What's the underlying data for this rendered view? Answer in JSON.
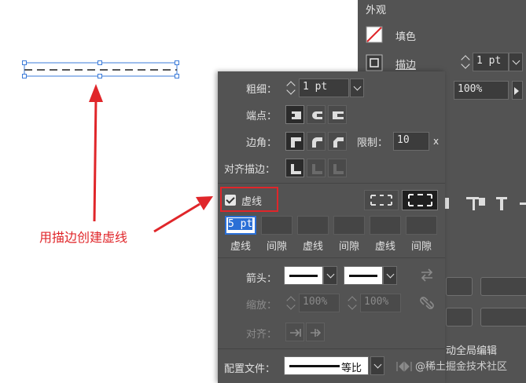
{
  "annotation": {
    "text": "用描边创建虚线"
  },
  "appearance_panel": {
    "title": "外观",
    "fill_label": "填色",
    "stroke_label": "描边",
    "stroke_weight": "1 pt",
    "opacity": "100%",
    "global_edit_label": "动全局编辑"
  },
  "stroke_panel": {
    "weight_label": "粗细：",
    "weight_value": "1 pt",
    "cap_label": "端点：",
    "corner_label": "边角：",
    "limit_label": "限制：",
    "limit_value": "10",
    "limit_unit": "x",
    "align_label": "对齐描边：",
    "dashed_label": "虚线",
    "dash_values": [
      "5 pt",
      "",
      "",
      "",
      "",
      ""
    ],
    "dash_labels": [
      "虚线",
      "间隙",
      "虚线",
      "间隙",
      "虚线",
      "间隙"
    ],
    "arrowhead_label": "箭头：",
    "scale_label": "缩放：",
    "scale_start": "100%",
    "scale_end": "100%",
    "arrow_align_label": "对齐：",
    "profile_label": "配置文件：",
    "profile_value": "等比"
  },
  "watermark": "@稀土掘金技术社区",
  "colors": {
    "panel_bg": "#535353",
    "accent_blue": "#2a6fd6",
    "annotation_red": "#e0262a"
  }
}
